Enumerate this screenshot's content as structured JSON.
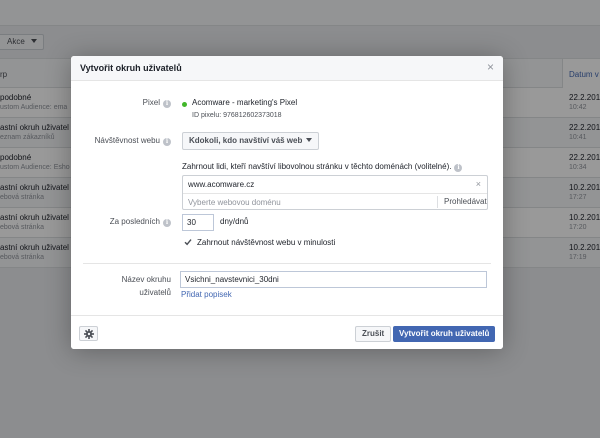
{
  "background": {
    "actions_label": "Akce",
    "table_header_left": "rp",
    "table_header_right": "Datum v",
    "rows": [
      {
        "title": "podobné",
        "subtitle": "ustom Audience: ema",
        "date": "22.2.201",
        "time": "10:42"
      },
      {
        "title": "astní okruh uživatel",
        "subtitle": "eznam zákazníků",
        "date": "22.2.201",
        "time": "10:41"
      },
      {
        "title": "podobné",
        "subtitle": "ustom Audience: Esho",
        "date": "22.2.201",
        "time": "10:34"
      },
      {
        "title": "astní okruh uživatel",
        "subtitle": "ebová stránka",
        "date": "10.2.201",
        "time": "17:27"
      },
      {
        "title": "astní okruh uživatel",
        "subtitle": "ebová stránka",
        "date": "10.2.201",
        "time": "17:20"
      },
      {
        "title": "astní okruh uživatel",
        "subtitle": "ebová stránka",
        "date": "10.2.201",
        "time": "17:19"
      }
    ]
  },
  "dialog": {
    "title": "Vytvořit okruh uživatelů",
    "close_symbol": "×",
    "pixel": {
      "label": "Pixel",
      "name": "Acomware - marketing's Pixel",
      "id_text": "ID pixelu: 976812602373018",
      "status_color": "#42b72a"
    },
    "traffic": {
      "label": "Návštěvnost webu",
      "selected": "Kdokoli, kdo navštíví váš web"
    },
    "domains": {
      "instruction": "Zahrnout lidi, kteří navštíví libovolnou stránku v těchto doménách (volitelné).",
      "items": [
        "www.acomware.cz"
      ],
      "remove_symbol": "×",
      "placeholder": "Vyberte webovou doménu",
      "browse_label": "Prohledávat"
    },
    "last_days": {
      "label": "Za posledních",
      "value": "30",
      "unit": "dny/dnů"
    },
    "include_past": {
      "label": "Zahrnout návštěvnost webu v minulosti",
      "checked": true
    },
    "audience_name": {
      "label_line1": "Název okruhu",
      "label_line2": "uživatelů",
      "value": "Vsichni_navstevnici_30dni",
      "add_description": "Přidat popisek"
    },
    "footer": {
      "cancel_label": "Zrušit",
      "create_label": "Vytvořit okruh uživatelů",
      "settings_icon": "gear-icon",
      "accent_color": "#4267b2"
    }
  }
}
